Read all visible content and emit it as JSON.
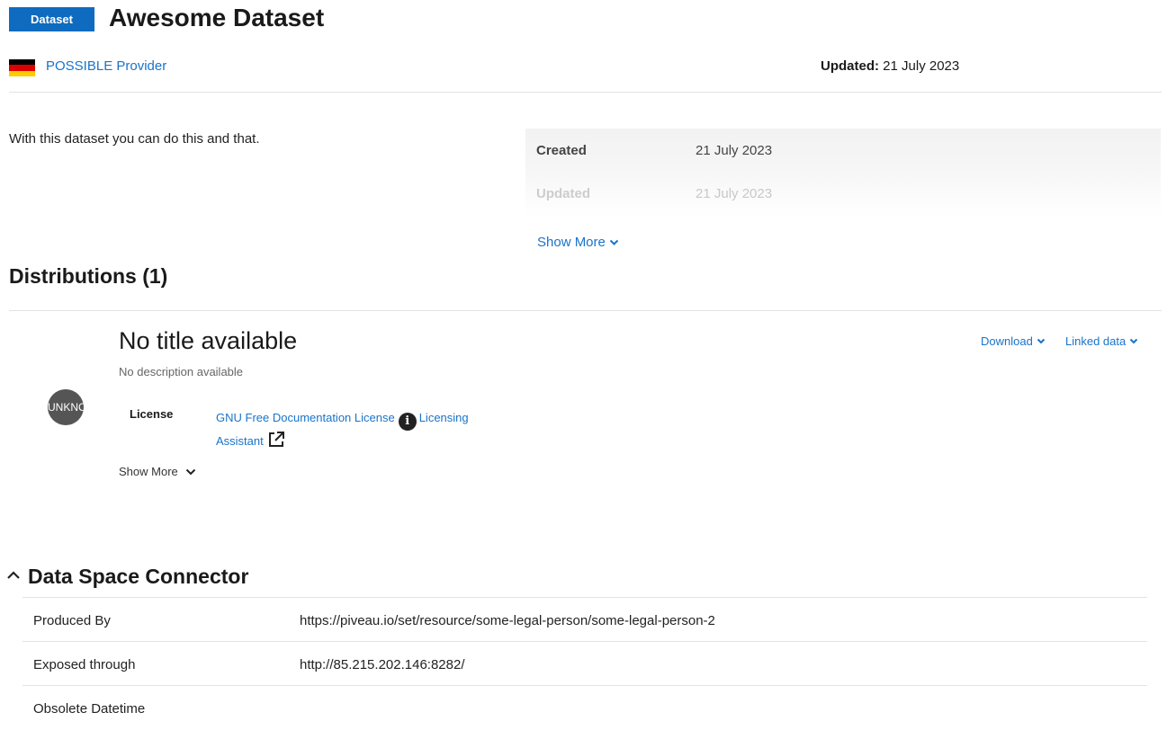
{
  "header": {
    "badge": "Dataset",
    "title": "Awesome Dataset"
  },
  "provider": {
    "name": "POSSIBLE Provider",
    "flag_colors": [
      "#000000",
      "#dd0000",
      "#ffcc00"
    ]
  },
  "updated": {
    "label": "Updated:",
    "value": "21 July 2023"
  },
  "description": "With this dataset you can do this and that.",
  "metadata": {
    "rows": [
      {
        "key": "Created",
        "value": "21 July 2023"
      },
      {
        "key": "Updated",
        "value": "21 July 2023"
      }
    ],
    "show_more": "Show More"
  },
  "distributions": {
    "heading": "Distributions (1)",
    "items": [
      {
        "format_badge": "UNKNOWN",
        "title": "No title available",
        "description": "No description available",
        "download_label": "Download",
        "linked_data_label": "Linked data",
        "license_label": "License",
        "license_name": "GNU Free Documentation License",
        "licensing_assistant": "Licensing Assistant",
        "show_more": "Show More"
      }
    ]
  },
  "connector": {
    "heading": "Data Space Connector",
    "rows": [
      {
        "key": "Produced By",
        "value": "https://piveau.io/set/resource/some-legal-person/some-legal-person-2"
      },
      {
        "key": "Exposed through",
        "value": "http://85.215.202.146:8282/"
      },
      {
        "key": "Obsolete Datetime",
        "value": ""
      }
    ]
  },
  "colors": {
    "accent": "#0e6bbf",
    "link": "#1a73c8"
  }
}
